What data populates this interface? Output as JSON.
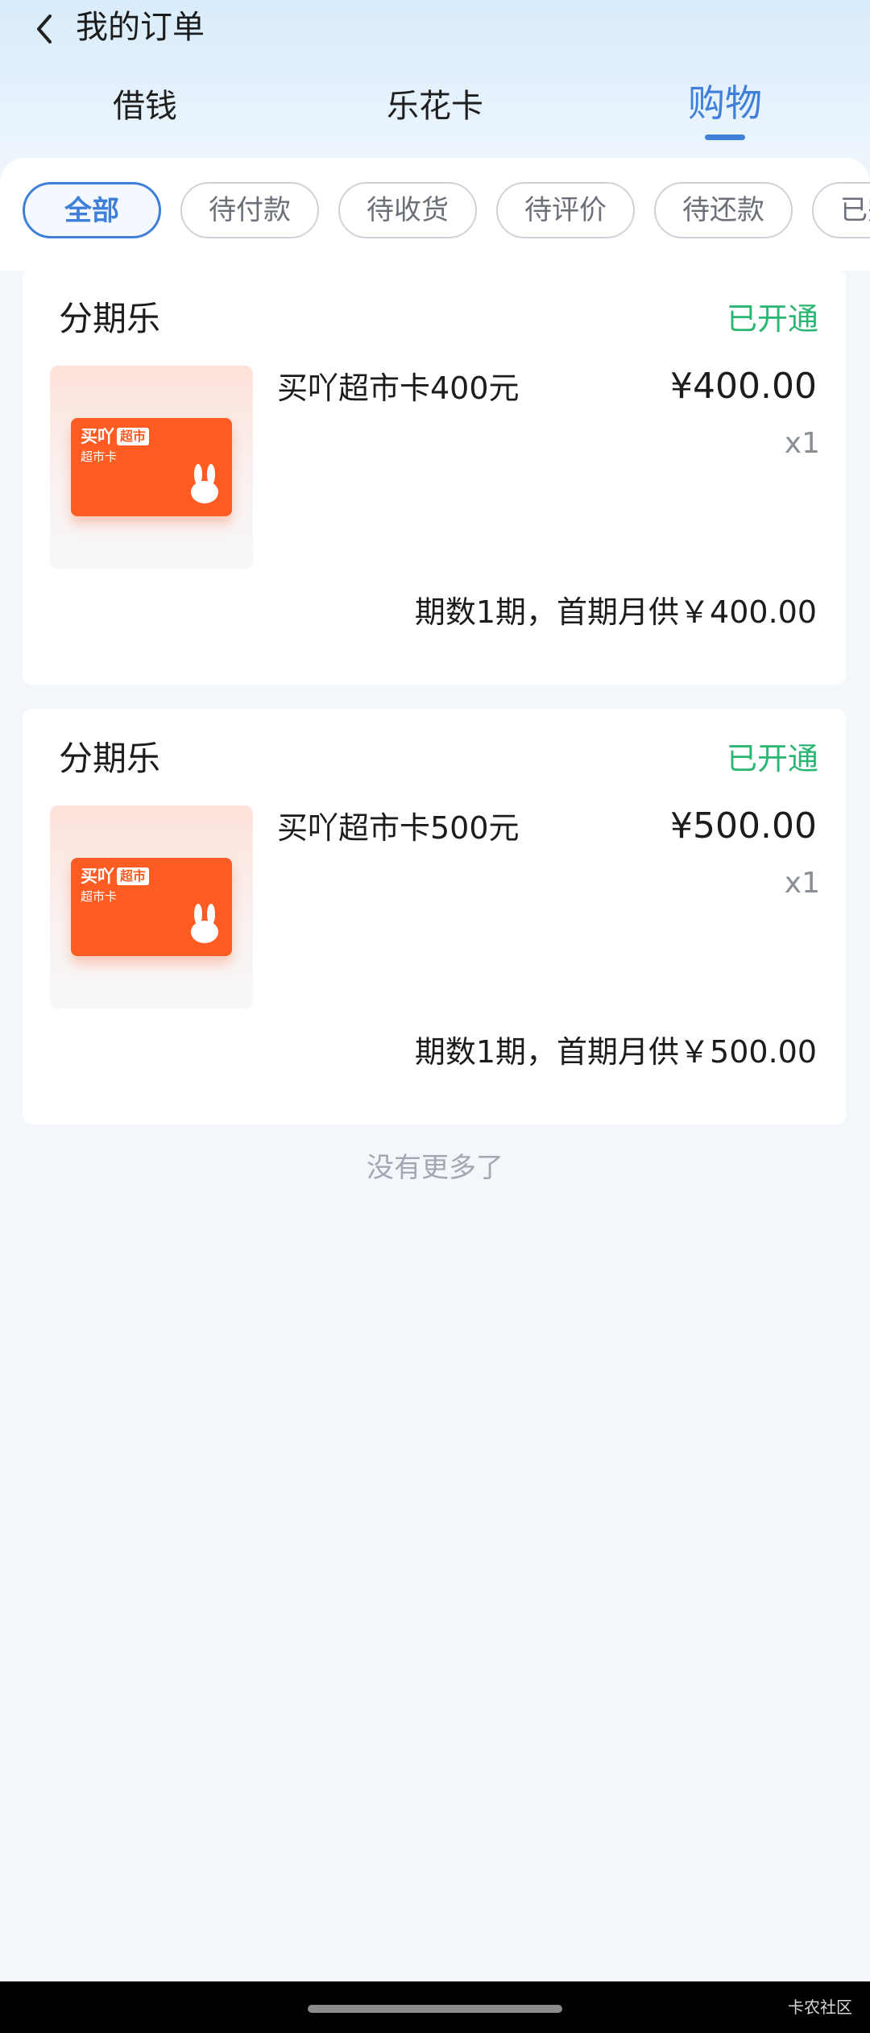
{
  "header": {
    "title": "我的订单"
  },
  "main_tabs": [
    {
      "label": "借钱",
      "active": false
    },
    {
      "label": "乐花卡",
      "active": false
    },
    {
      "label": "购物",
      "active": true
    }
  ],
  "filters": [
    {
      "label": "全部",
      "active": true
    },
    {
      "label": "待付款",
      "active": false
    },
    {
      "label": "待收货",
      "active": false
    },
    {
      "label": "待评价",
      "active": false
    },
    {
      "label": "待还款",
      "active": false
    },
    {
      "label": "已完成",
      "active": false
    }
  ],
  "orders": [
    {
      "shop": "分期乐",
      "status": "已开通",
      "product_name": "买吖超市卡400元",
      "price": "¥400.00",
      "quantity": "x1",
      "plan": "期数1期，首期月供￥400.00",
      "thumb": {
        "brand": "买吖",
        "badge": "超市",
        "sub": "超市卡"
      }
    },
    {
      "shop": "分期乐",
      "status": "已开通",
      "product_name": "买吖超市卡500元",
      "price": "¥500.00",
      "quantity": "x1",
      "plan": "期数1期，首期月供￥500.00",
      "thumb": {
        "brand": "买吖",
        "badge": "超市",
        "sub": "超市卡"
      }
    }
  ],
  "footer_note": "没有更多了",
  "watermark": "卡农社区",
  "colors": {
    "accent": "#3f7fd9",
    "status_green": "#2bb673",
    "card_orange": "#ff5c24"
  },
  "icons": {
    "back": "chevron-left-icon",
    "thumb_mascot": "rabbit-icon"
  }
}
